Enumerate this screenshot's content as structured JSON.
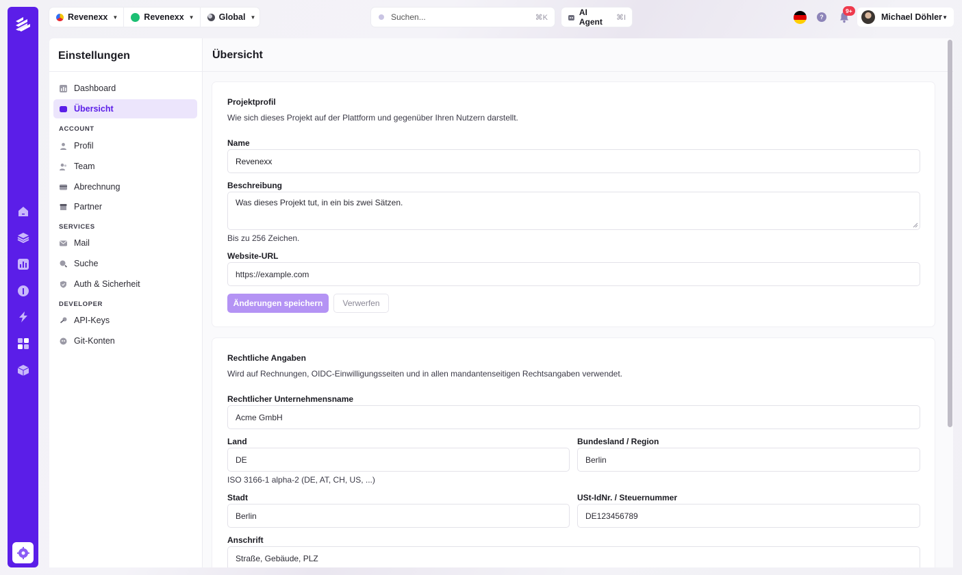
{
  "topbar": {
    "switchers": [
      {
        "label": "Revenexx",
        "icon": "revenexx-logo-icon",
        "color": "#f5c400"
      },
      {
        "label": "Revenexx",
        "icon": "green-dot-icon",
        "color": "#1cbf73"
      },
      {
        "label": "Global",
        "icon": "globe-icon",
        "color": "#6b6b7a"
      }
    ],
    "search": {
      "placeholder": "Suchen...",
      "shortcut": "⌘K"
    },
    "ai_agent": {
      "label": "AI Agent",
      "shortcut": "⌘I"
    },
    "language": "de-flag-icon",
    "notifications_badge": "9+",
    "user": {
      "name": "Michael Döhler"
    }
  },
  "settings_nav": {
    "title": "Einstellungen",
    "items_top": [
      {
        "label": "Dashboard",
        "icon": "dashboard-icon",
        "active": false
      },
      {
        "label": "Übersicht",
        "icon": "overview-icon",
        "active": true
      }
    ],
    "sections": [
      {
        "heading": "ACCOUNT",
        "items": [
          {
            "label": "Profil",
            "icon": "user-icon"
          },
          {
            "label": "Team",
            "icon": "team-icon"
          },
          {
            "label": "Abrechnung",
            "icon": "billing-icon"
          },
          {
            "label": "Partner",
            "icon": "store-icon"
          }
        ]
      },
      {
        "heading": "SERVICES",
        "items": [
          {
            "label": "Mail",
            "icon": "mail-icon"
          },
          {
            "label": "Suche",
            "icon": "search-icon"
          },
          {
            "label": "Auth & Sicherheit",
            "icon": "shield-icon"
          }
        ]
      },
      {
        "heading": "DEVELOPER",
        "items": [
          {
            "label": "API-Keys",
            "icon": "key-icon"
          },
          {
            "label": "Git-Konten",
            "icon": "git-icon"
          }
        ]
      }
    ]
  },
  "page": {
    "title": "Übersicht"
  },
  "project_profile": {
    "title": "Projektprofil",
    "description": "Wie sich dieses Projekt auf der Plattform und gegenüber Ihren Nutzern darstellt.",
    "name_label": "Name",
    "name_value": "Revenexx",
    "desc_label": "Beschreibung",
    "desc_placeholder": "Was dieses Projekt tut, in ein bis zwei Sätzen.",
    "desc_hint": "Bis zu 256 Zeichen.",
    "website_label": "Website-URL",
    "website_placeholder": "https://example.com",
    "save_label": "Änderungen speichern",
    "discard_label": "Verwerfen"
  },
  "legal": {
    "title": "Rechtliche Angaben",
    "description": "Wird auf Rechnungen, OIDC-Einwilligungsseiten und in allen mandantenseitigen Rechtsangaben verwendet.",
    "company_label": "Rechtlicher Unternehmensname",
    "company_placeholder": "Acme GmbH",
    "country_label": "Land",
    "country_placeholder": "DE",
    "country_hint": "ISO 3166-1 alpha-2 (DE, AT, CH, US, ...)",
    "region_label": "Bundesland / Region",
    "region_placeholder": "Berlin",
    "city_label": "Stadt",
    "city_placeholder": "Berlin",
    "vat_label": "USt-IdNr. / Steuernummer",
    "vat_placeholder": "DE123456789",
    "address_label": "Anschrift",
    "address_placeholder": "Straße, Gebäude, PLZ"
  },
  "colors": {
    "accent": "#5b1ee8",
    "accent_light": "#ece5fc",
    "button_disabled": "#b493f4"
  }
}
